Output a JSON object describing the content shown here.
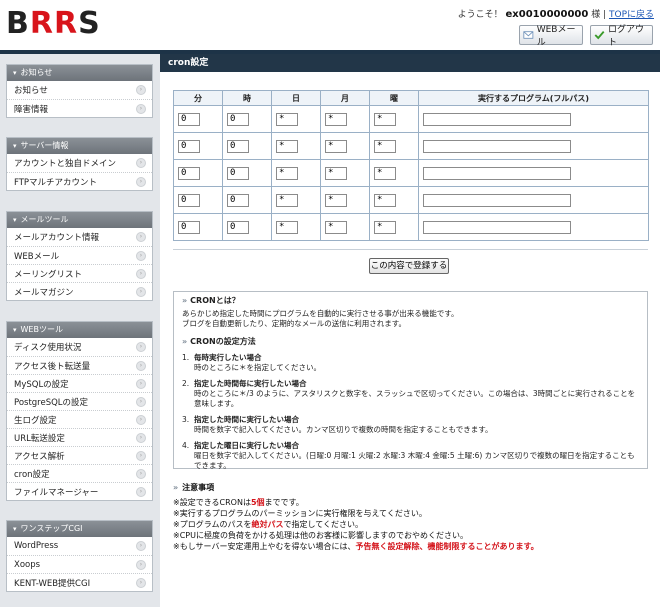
{
  "header": {
    "logo": [
      "B",
      "RR",
      "S"
    ],
    "greeting": "ようこそ！",
    "account": "ex0010000000",
    "honorific": "様 |",
    "top_link": "TOPに戻る",
    "webmail_btn": "WEBメール",
    "logout_btn": "ログアウト"
  },
  "sidebar": {
    "groups": [
      {
        "title": "お知らせ",
        "items": [
          "お知らせ",
          "障害情報"
        ]
      },
      {
        "title": "サーバー情報",
        "items": [
          "アカウントと独自ドメイン",
          "FTPマルチアカウント"
        ]
      },
      {
        "title": "メールツール",
        "items": [
          "メールアカウント情報",
          "WEBメール",
          "メーリングリスト",
          "メールマガジン"
        ]
      },
      {
        "title": "WEBツール",
        "items": [
          "ディスク使用状況",
          "アクセス後ト転送量",
          "MySQLの設定",
          "PostgreSQLの設定",
          "生ログ設定",
          "URL転送設定",
          "アクセス解析",
          "cron設定",
          "ファイルマネージャー"
        ]
      },
      {
        "title": "ワンステップCGI",
        "items": [
          "WordPress",
          "Xoops",
          "KENT-WEB提供CGI"
        ]
      }
    ]
  },
  "main": {
    "title": "cron設定",
    "columns": [
      "分",
      "時",
      "日",
      "月",
      "曜",
      "実行するプログラム(フルパス)"
    ],
    "rows": [
      [
        "0",
        "0",
        "*",
        "*",
        "*",
        ""
      ],
      [
        "0",
        "0",
        "*",
        "*",
        "*",
        ""
      ],
      [
        "0",
        "0",
        "*",
        "*",
        "*",
        ""
      ],
      [
        "0",
        "0",
        "*",
        "*",
        "*",
        ""
      ],
      [
        "0",
        "0",
        "*",
        "*",
        "*",
        ""
      ]
    ],
    "submit": "この内容で登録する"
  },
  "info": {
    "what_title": "CRONとは？",
    "what_p1": "あらかじめ指定した時間にプログラムを自動的に実行させる事が出来る機能です。",
    "what_p2": "ブログを自動更新したり、定期的なメールの送信に利用されます。",
    "howto_title": "CRONの設定方法",
    "items": [
      {
        "n": "1.",
        "h": "毎時実行したい場合",
        "d": "時のところに＊を指定してください。"
      },
      {
        "n": "2.",
        "h": "指定した時間毎に実行したい場合",
        "d": "時のところに＊/3 のように、アスタリスクと数字を、スラッシュで区切ってください。この場合は、3時間ごとに実行されることを意味します。"
      },
      {
        "n": "3.",
        "h": "指定した時間に実行したい場合",
        "d": "時間を数字で記入してください。カンマ区切りで複数の時間を指定することもできます。"
      },
      {
        "n": "4.",
        "h": "指定した曜日に実行したい場合",
        "d": "曜日を数字で記入してください。(日曜:0 月曜:1 火曜:2 水曜:3 木曜:4 金曜:5 土曜:6) カンマ区切りで複数の曜日を指定することもできます。"
      }
    ]
  },
  "notes": {
    "title": "注意事項",
    "n1a": "※設定できるCRONは",
    "n1b": "5個",
    "n1c": "までです。",
    "n2": "※実行するプログラムのパーミッションに実行権限を与えてください。",
    "n3a": "※プログラムのパスを",
    "n3b": "絶対パス",
    "n3c": "で指定してください。",
    "n4": "※CPUに極度の負荷をかける処理は他のお客様に影響しますのでおやめください。",
    "n5a": "※もしサーバー安定運用上やむを得ない場合には、",
    "n5b": "予告無く設定解除、機能制限することがあります。"
  }
}
